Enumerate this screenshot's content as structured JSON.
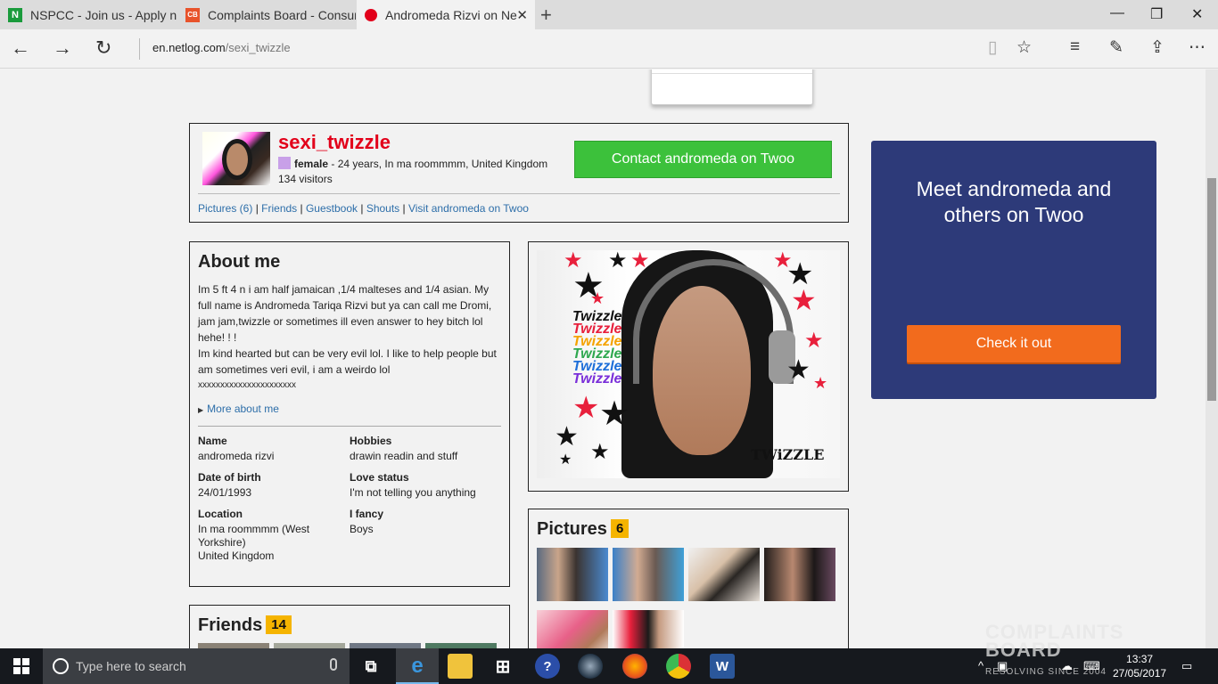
{
  "browser": {
    "tabs": [
      {
        "title": "NSPCC - Join us - Apply no",
        "favicon": "N"
      },
      {
        "title": "Complaints Board - Consum",
        "favicon": "CB"
      },
      {
        "title": "Andromeda Rizvi on Ne",
        "favicon": "netlog"
      }
    ],
    "url_domain": "en.netlog.com",
    "url_path": "/sexi_twizzle"
  },
  "profile": {
    "username": "sexi_twizzle",
    "gender": "female",
    "info": " - 24 years, In ma roommmm, United Kingdom",
    "visitors": "134 visitors",
    "contact_button": "Contact andromeda on Twoo",
    "links": [
      "Pictures (6)",
      "Friends",
      "Guestbook",
      "Shouts",
      "Visit andromeda on Twoo"
    ]
  },
  "about": {
    "title": "About me",
    "p1": "Im 5 ft 4 n i am half jamaican ,1/4 malteses and 1/4 asian. My full name is Andromeda Tariqa Rizvi but ya can call me Dromi, jam jam,twizzle or sometimes ill even answer to hey bitch lol hehe! ! !",
    "p2": "Im kind hearted but can be very evil lol. I like to help people but am sometimes veri evil, i am a weirdo lol",
    "p3": "xxxxxxxxxxxxxxxxxxxxxx",
    "more": "More about me",
    "fields": {
      "name_label": "Name",
      "name": "andromeda rizvi",
      "hobbies_label": "Hobbies",
      "hobbies": "drawin readin and stuff",
      "dob_label": "Date of birth",
      "dob": "24/01/1993",
      "love_label": "Love status",
      "love": "I'm not telling you anything",
      "location_label": "Location",
      "location_1": "In ma roommmm (West",
      "location_2": "Yorkshire)",
      "location_3": "United Kingdom",
      "fancy_label": "I fancy",
      "fancy": "Boys"
    }
  },
  "photo": {
    "twizzle_text": "Twizzle",
    "signature": "TWiZZLE"
  },
  "pictures": {
    "title": "Pictures",
    "count": "6"
  },
  "friends": {
    "title": "Friends",
    "count": "14"
  },
  "twoo_ad": {
    "title_1": "Meet andromeda and",
    "title_2": "others on Twoo",
    "button": "Check it out"
  },
  "taskbar": {
    "search_placeholder": "Type here to search",
    "time": "13:37",
    "date": "27/05/2017"
  },
  "watermark": {
    "line1": "COMPLAINTS",
    "line2": "BOARD",
    "tagline": "RESOLVING SINCE 2004"
  },
  "colors": {
    "username": "#e2001a",
    "contact": "#3cc13b",
    "twoo_bg": "#2d3a79",
    "checkout": "#f26b1d",
    "link": "#2d6ea9",
    "badge": "#f5b400"
  }
}
